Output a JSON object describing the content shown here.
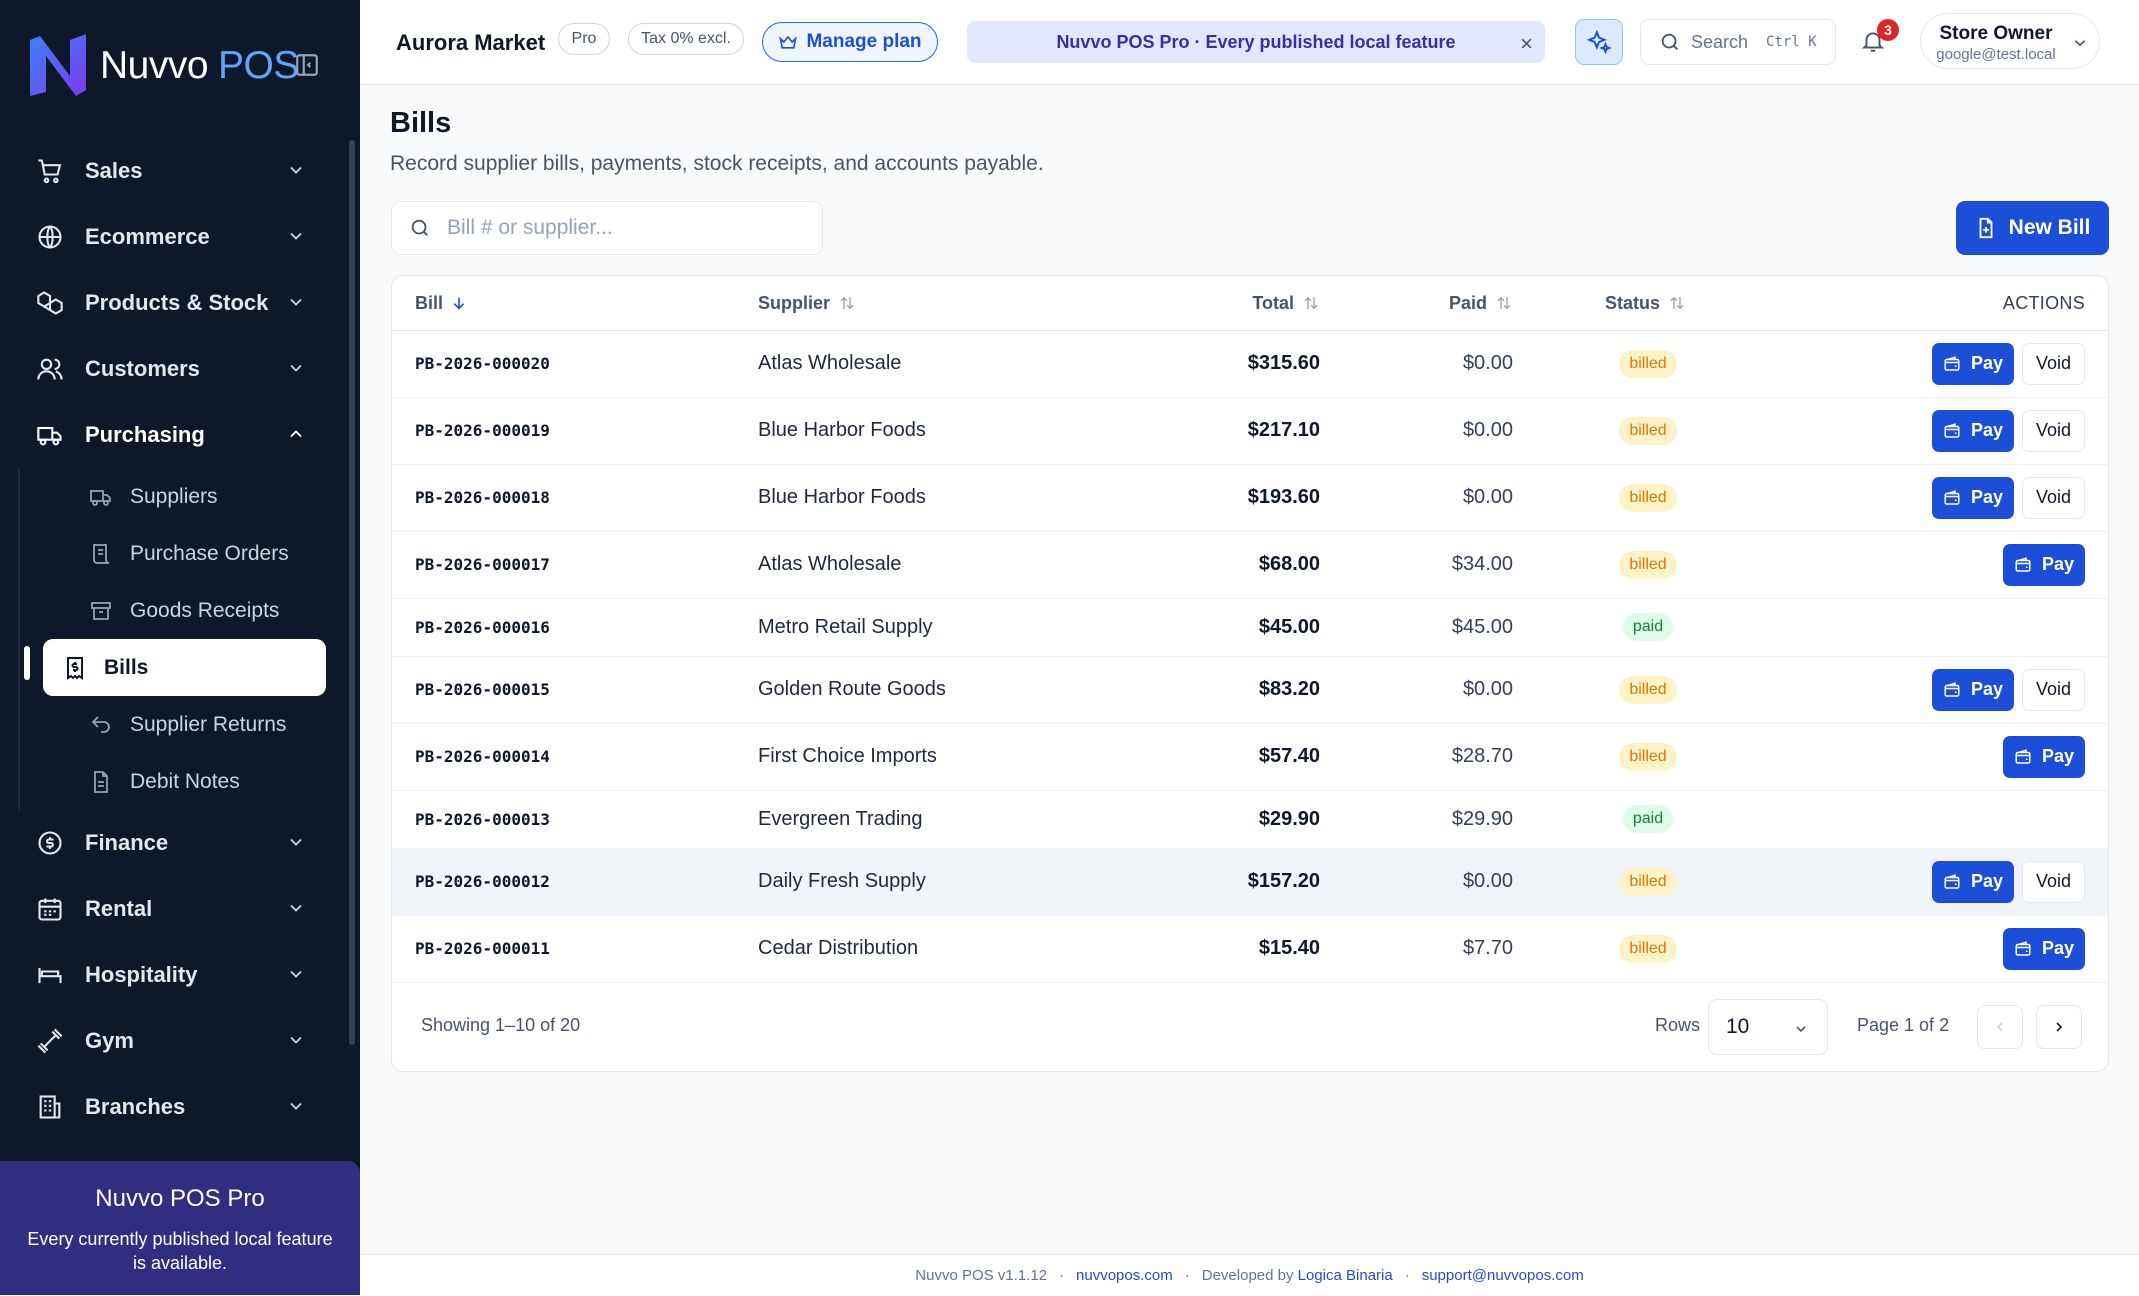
{
  "app": {
    "brand_name": "Nuvvo",
    "brand_suffix": "POS",
    "accent_color": "#1d4ed8"
  },
  "sidebar": {
    "items": [
      {
        "label": "Sales",
        "icon": "cart-icon"
      },
      {
        "label": "Ecommerce",
        "icon": "globe-icon"
      },
      {
        "label": "Products & Stock",
        "icon": "boxes-icon"
      },
      {
        "label": "Customers",
        "icon": "users-icon"
      },
      {
        "label": "Purchasing",
        "icon": "truck-icon"
      },
      {
        "label": "Finance",
        "icon": "dollar-icon"
      },
      {
        "label": "Rental",
        "icon": "calendar-icon"
      },
      {
        "label": "Hospitality",
        "icon": "bed-icon"
      },
      {
        "label": "Gym",
        "icon": "dumbbell-icon"
      },
      {
        "label": "Branches",
        "icon": "building-icon"
      }
    ],
    "purchasing_sub": [
      {
        "label": "Suppliers",
        "icon": "truck-icon"
      },
      {
        "label": "Purchase Orders",
        "icon": "scroll-icon"
      },
      {
        "label": "Goods Receipts",
        "icon": "archive-icon"
      },
      {
        "label": "Bills",
        "icon": "receipt-icon",
        "active": true
      },
      {
        "label": "Supplier Returns",
        "icon": "undo-icon"
      },
      {
        "label": "Debit Notes",
        "icon": "file-text-icon"
      }
    ],
    "promo": {
      "title": "Nuvvo POS Pro",
      "description": "Every currently published local feature is available."
    }
  },
  "topbar": {
    "store_name": "Aurora Market",
    "plan_badge": "Pro",
    "tax_badge": "Tax 0% excl.",
    "manage_plan": "Manage plan",
    "banner_text": "Nuvvo POS Pro · Every published local feature",
    "banner_close": "×",
    "search_label": "Search",
    "search_shortcut": "Ctrl K",
    "notifications_count": "3",
    "user_name": "Store Owner",
    "user_email": "google@test.local"
  },
  "page": {
    "title": "Bills",
    "subtitle": "Record supplier bills, payments, stock receipts, and accounts payable.",
    "search_placeholder": "Bill # or supplier...",
    "search_value": "",
    "new_button": "New Bill"
  },
  "table": {
    "headers": {
      "bill": "Bill",
      "supplier": "Supplier",
      "total": "Total",
      "paid": "Paid",
      "status": "Status",
      "actions": "ACTIONS"
    },
    "pay_label": "Pay",
    "void_label": "Void",
    "rows": [
      {
        "bill": "PB-2026-000020",
        "supplier": "Atlas Wholesale",
        "total": "$315.60",
        "paid": "$0.00",
        "status": "billed",
        "actions": [
          "pay",
          "void"
        ]
      },
      {
        "bill": "PB-2026-000019",
        "supplier": "Blue Harbor Foods",
        "total": "$217.10",
        "paid": "$0.00",
        "status": "billed",
        "actions": [
          "pay",
          "void"
        ]
      },
      {
        "bill": "PB-2026-000018",
        "supplier": "Blue Harbor Foods",
        "total": "$193.60",
        "paid": "$0.00",
        "status": "billed",
        "actions": [
          "pay",
          "void"
        ]
      },
      {
        "bill": "PB-2026-000017",
        "supplier": "Atlas Wholesale",
        "total": "$68.00",
        "paid": "$34.00",
        "status": "billed",
        "actions": [
          "pay"
        ]
      },
      {
        "bill": "PB-2026-000016",
        "supplier": "Metro Retail Supply",
        "total": "$45.00",
        "paid": "$45.00",
        "status": "paid",
        "actions": []
      },
      {
        "bill": "PB-2026-000015",
        "supplier": "Golden Route Goods",
        "total": "$83.20",
        "paid": "$0.00",
        "status": "billed",
        "actions": [
          "pay",
          "void"
        ]
      },
      {
        "bill": "PB-2026-000014",
        "supplier": "First Choice Imports",
        "total": "$57.40",
        "paid": "$28.70",
        "status": "billed",
        "actions": [
          "pay"
        ]
      },
      {
        "bill": "PB-2026-000013",
        "supplier": "Evergreen Trading",
        "total": "$29.90",
        "paid": "$29.90",
        "status": "paid",
        "actions": []
      },
      {
        "bill": "PB-2026-000012",
        "supplier": "Daily Fresh Supply",
        "total": "$157.20",
        "paid": "$0.00",
        "status": "billed",
        "actions": [
          "pay",
          "void"
        ]
      },
      {
        "bill": "PB-2026-000011",
        "supplier": "Cedar Distribution",
        "total": "$15.40",
        "paid": "$7.70",
        "status": "billed",
        "actions": [
          "pay"
        ]
      }
    ],
    "showing": "Showing 1–10 of 20",
    "rows_label": "Rows",
    "rows_value": "10",
    "page_label": "Page 1 of 2"
  },
  "footer": {
    "version": "Nuvvo POS v1.1.12",
    "site": "nuvvopos.com",
    "developed_by": "Developed by",
    "developer": "Logica Binaria",
    "support": "support@nuvvopos.com"
  }
}
